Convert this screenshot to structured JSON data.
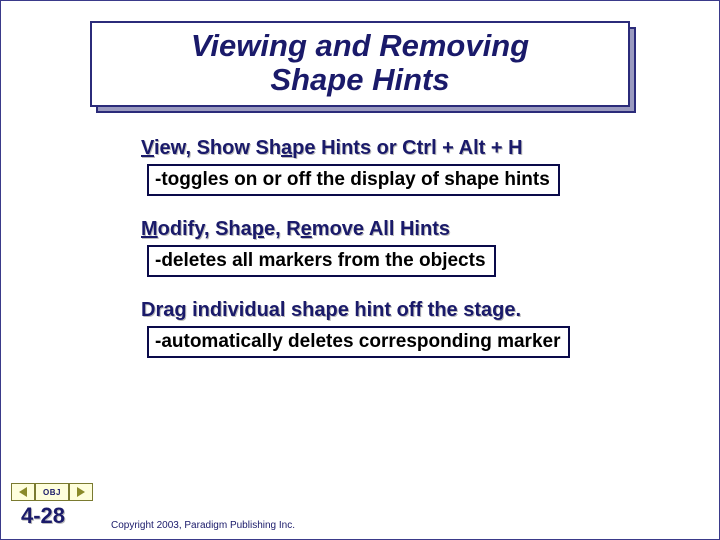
{
  "title_line1": "Viewing and Removing",
  "title_line2": "Shape Hints",
  "sections": [
    {
      "heading_parts": [
        "V",
        "iew, Show Sh",
        "a",
        "pe Hints or Ctrl + Alt + H"
      ],
      "underline_idx": [
        0,
        2
      ],
      "detail": "-toggles on or off the display of shape hints"
    },
    {
      "heading_parts": [
        "M",
        "odify, Sha",
        "p",
        "e, R",
        "e",
        "move All Hints"
      ],
      "underline_idx": [
        0,
        2,
        4
      ],
      "detail": "-deletes all markers from the objects"
    },
    {
      "heading_parts": [
        "Drag individual shape hint off the stage."
      ],
      "underline_idx": [],
      "detail": "-automatically deletes corresponding marker"
    }
  ],
  "nav": {
    "obj_label": "OBJ"
  },
  "slide_number": "4-28",
  "copyright": "Copyright 2003, Paradigm Publishing Inc."
}
